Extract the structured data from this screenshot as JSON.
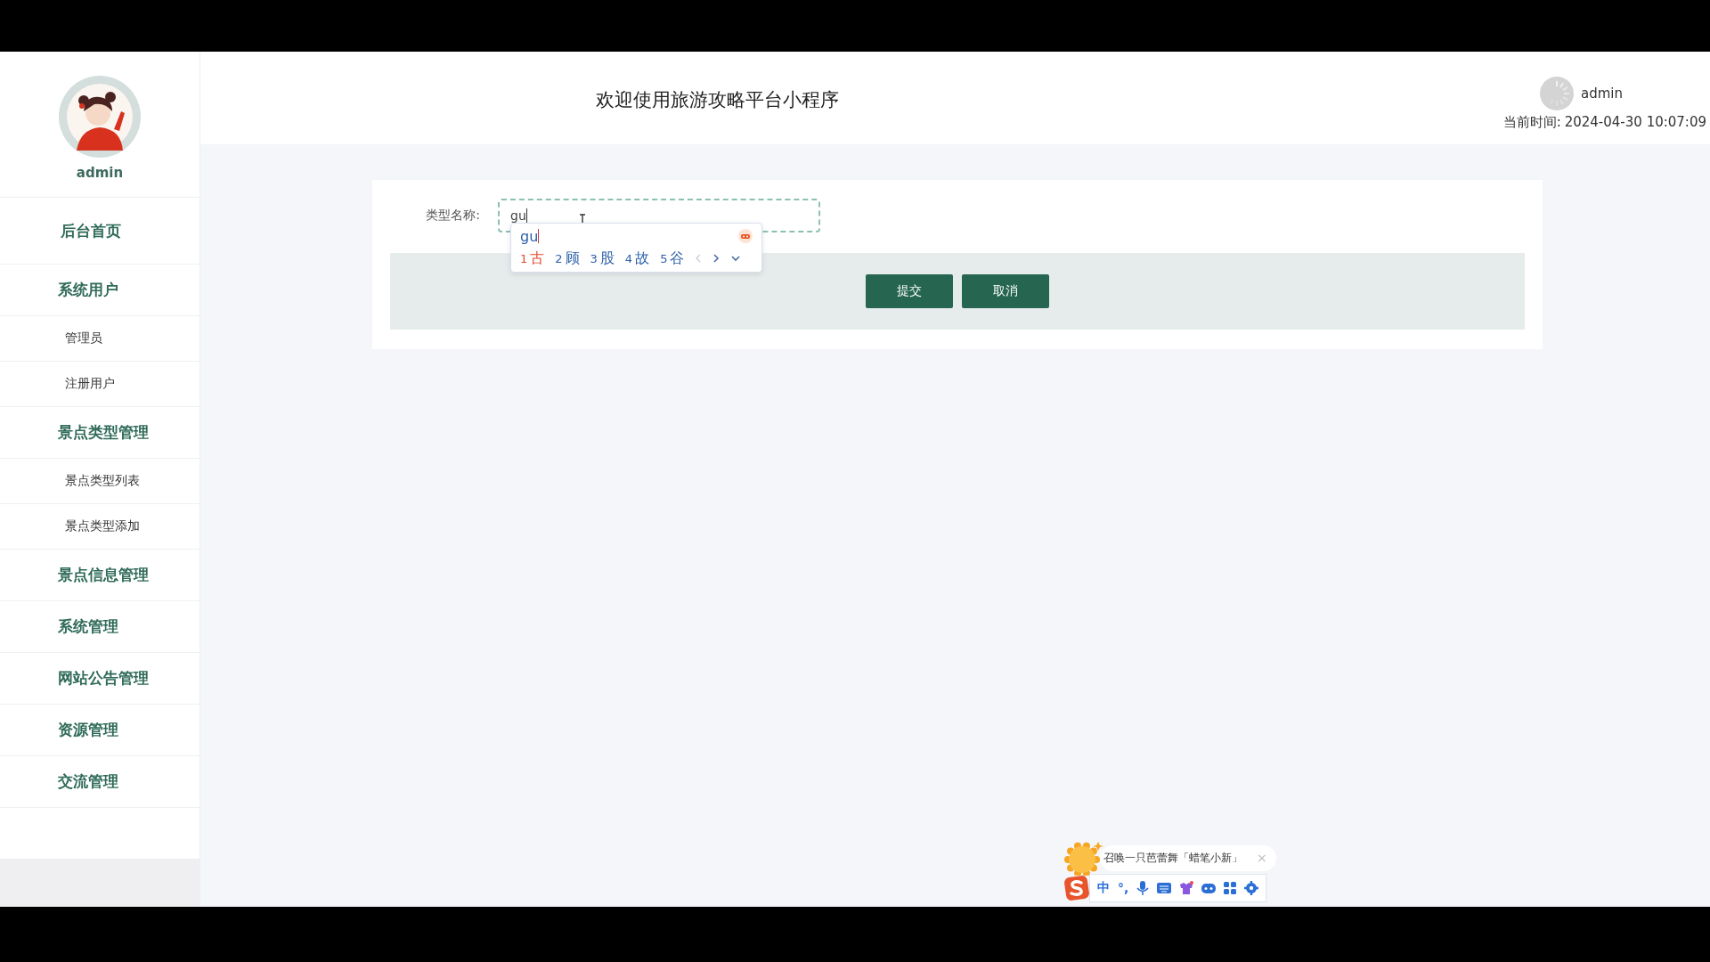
{
  "sidebar": {
    "user": "admin",
    "menu": [
      {
        "label": "后台首页"
      },
      {
        "label": "系统用户",
        "children": [
          {
            "label": "管理员"
          },
          {
            "label": "注册用户"
          }
        ]
      },
      {
        "label": "景点类型管理",
        "children": [
          {
            "label": "景点类型列表"
          },
          {
            "label": "景点类型添加"
          }
        ]
      },
      {
        "label": "景点信息管理"
      },
      {
        "label": "系统管理"
      },
      {
        "label": "网站公告管理"
      },
      {
        "label": "资源管理"
      },
      {
        "label": "交流管理"
      }
    ]
  },
  "header": {
    "title": "欢迎使用旅游攻略平台小程序",
    "user": "admin",
    "time_label": "当前时间:",
    "time": "2024-04-30 10:07:09"
  },
  "form": {
    "label": "类型名称:",
    "value": "gu",
    "buttons": [
      "提交",
      "取消"
    ]
  },
  "ime": {
    "composition": "gu",
    "candidates": [
      {
        "index": "1",
        "text": "古",
        "selected": true
      },
      {
        "index": "2",
        "text": "顾",
        "selected": false
      },
      {
        "index": "3",
        "text": "股",
        "selected": false
      },
      {
        "index": "4",
        "text": "故",
        "selected": false
      },
      {
        "index": "5",
        "text": "谷",
        "selected": false
      }
    ],
    "tip": "召唤一只芭蕾舞「蜡笔小新」",
    "close": "×",
    "toolbar": [
      "中",
      "°,"
    ]
  }
}
